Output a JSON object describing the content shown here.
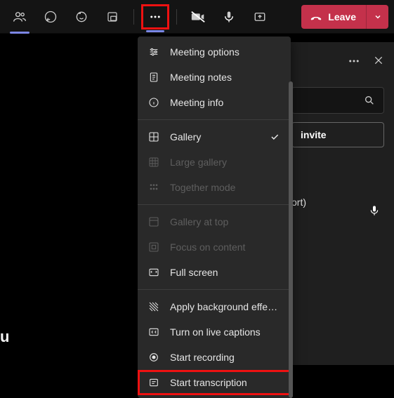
{
  "toolbar": {
    "leave_label": "Leave"
  },
  "dropdown": {
    "meeting_options": "Meeting options",
    "meeting_notes": "Meeting notes",
    "meeting_info": "Meeting info",
    "gallery": "Gallery",
    "large_gallery": "Large gallery",
    "together_mode": "Together mode",
    "gallery_at_top": "Gallery at top",
    "focus_content": "Focus on content",
    "full_screen": "Full screen",
    "apply_bg": "Apply background effe…",
    "live_captions": "Turn on live captions",
    "start_recording": "Start recording",
    "start_transcription": "Start transcription"
  },
  "panel": {
    "invite_label": "invite",
    "ort_text": "ort)"
  },
  "stub": "u"
}
